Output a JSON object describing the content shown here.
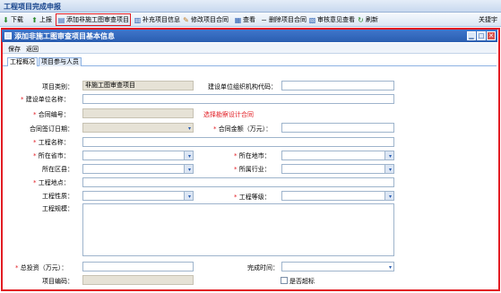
{
  "app": {
    "title": "工程项目完成申报"
  },
  "toolbar": {
    "items": [
      {
        "icon": "down-arrow-icon",
        "label": "下载"
      },
      {
        "icon": "up-arrow-icon",
        "label": "上报"
      },
      {
        "icon": "add-doc-icon",
        "label": "添加非施工图审查项目"
      },
      {
        "icon": "doc-plus-icon",
        "label": "补充项目信息"
      },
      {
        "icon": "edit-pen-icon",
        "label": "修改项目合同"
      },
      {
        "icon": "view-icon",
        "label": "查看"
      },
      {
        "icon": "delete-icon",
        "label": "删除项目合同"
      },
      {
        "icon": "review-icon",
        "label": "审核意见查看"
      },
      {
        "icon": "refresh-icon",
        "label": "刷新"
      }
    ],
    "user": "关捷宇"
  },
  "window": {
    "title": "添加非施工图审查项目基本信息",
    "actions": [
      "保存",
      "返回"
    ]
  },
  "tabs": [
    "工程概况",
    "项目参与人员"
  ],
  "form": {
    "project_type_label": "项目类别：",
    "project_type_value": "非施工图审查项目",
    "org_code_label": "建设单位组织机构代码：",
    "builder_name_label": "建设单位名称：",
    "contract_no_label": "合同编号：",
    "select_contract_note": "选择勘察设计合同",
    "contract_date_label": "合同签订日期：",
    "contract_amount_label": "合同金额（万元）：",
    "project_name_label": "工程名称：",
    "province_label": "所在省市：",
    "city_label": "所在地市：",
    "district_label": "所在区县：",
    "industry_label": "所属行业：",
    "location_label": "工程地点：",
    "nature_label": "工程性质：",
    "grade_label": "工程等级：",
    "scale_label": "工程规模：",
    "total_invest_label": "总投资（万元）：",
    "finish_time_label": "完成时间：",
    "project_code_label": "项目编码：",
    "is_overdue_label": "是否超标"
  }
}
